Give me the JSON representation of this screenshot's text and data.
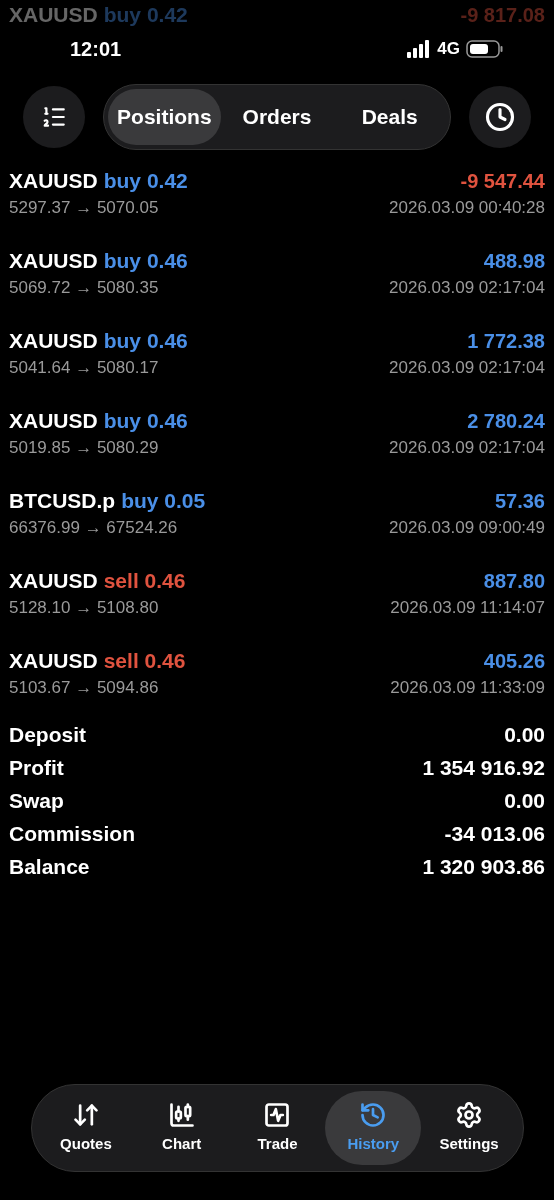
{
  "status_bar": {
    "time": "12:01",
    "network": "4G"
  },
  "faded_deal": {
    "symbol": "XAUUSD",
    "side": "buy",
    "volume": "0.42",
    "profit": "-9 817.08",
    "kind": "loss"
  },
  "header": {
    "tabs": [
      {
        "label": "Positions",
        "selected": true
      },
      {
        "label": "Orders",
        "selected": false
      },
      {
        "label": "Deals",
        "selected": false
      }
    ]
  },
  "deals": [
    {
      "symbol": "XAUUSD",
      "side": "buy",
      "volume": "0.42",
      "profit": "-9 547.44",
      "kind": "loss",
      "prices": "5297.37 → 5070.05",
      "time": "2026.03.09 00:40:28"
    },
    {
      "symbol": "XAUUSD",
      "side": "buy",
      "volume": "0.46",
      "profit": "488.98",
      "kind": "gain",
      "prices": "5069.72 → 5080.35",
      "time": "2026.03.09 02:17:04"
    },
    {
      "symbol": "XAUUSD",
      "side": "buy",
      "volume": "0.46",
      "profit": "1 772.38",
      "kind": "gain",
      "prices": "5041.64 → 5080.17",
      "time": "2026.03.09 02:17:04"
    },
    {
      "symbol": "XAUUSD",
      "side": "buy",
      "volume": "0.46",
      "profit": "2 780.24",
      "kind": "gain",
      "prices": "5019.85 → 5080.29",
      "time": "2026.03.09 02:17:04"
    },
    {
      "symbol": "BTCUSD.p",
      "side": "buy",
      "volume": "0.05",
      "profit": "57.36",
      "kind": "gain",
      "prices": "66376.99 → 67524.26",
      "time": "2026.03.09 09:00:49"
    },
    {
      "symbol": "XAUUSD",
      "side": "sell",
      "volume": "0.46",
      "profit": "887.80",
      "kind": "gain",
      "prices": "5128.10 → 5108.80",
      "time": "2026.03.09 11:14:07"
    },
    {
      "symbol": "XAUUSD",
      "side": "sell",
      "volume": "0.46",
      "profit": "405.26",
      "kind": "gain",
      "prices": "5103.67 → 5094.86",
      "time": "2026.03.09 11:33:09"
    }
  ],
  "summary": [
    {
      "label": "Deposit",
      "value": "0.00"
    },
    {
      "label": "Profit",
      "value": "1 354 916.92"
    },
    {
      "label": "Swap",
      "value": "0.00"
    },
    {
      "label": "Commission",
      "value": "-34 013.06"
    },
    {
      "label": "Balance",
      "value": "1 320 903.86"
    }
  ],
  "tab_bar": [
    {
      "label": "Quotes",
      "selected": false
    },
    {
      "label": "Chart",
      "selected": false
    },
    {
      "label": "Trade",
      "selected": false
    },
    {
      "label": "History",
      "selected": true
    },
    {
      "label": "Settings",
      "selected": false
    }
  ]
}
